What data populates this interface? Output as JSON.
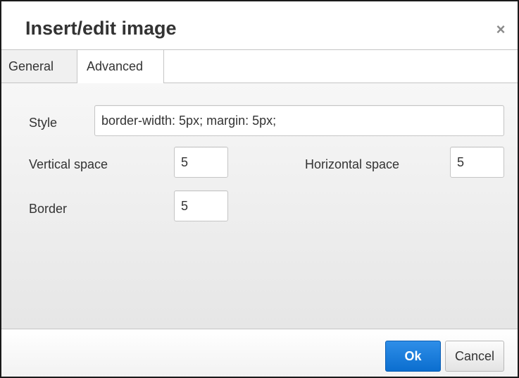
{
  "dialog": {
    "title": "Insert/edit image",
    "close_glyph": "×"
  },
  "tabs": [
    {
      "label": "General",
      "active": false
    },
    {
      "label": "Advanced",
      "active": true
    }
  ],
  "form": {
    "style": {
      "label": "Style",
      "value": "border-width: 5px; margin: 5px;"
    },
    "vertical_space": {
      "label": "Vertical space",
      "value": "5"
    },
    "horizontal_space": {
      "label": "Horizontal space",
      "value": "5"
    },
    "border": {
      "label": "Border",
      "value": "5"
    }
  },
  "buttons": {
    "ok_label": "Ok",
    "cancel_label": "Cancel"
  },
  "colors": {
    "accent": "#0b6ecf",
    "panel_bg": "#f0f0f0"
  },
  "icons": {
    "close": "close-icon"
  }
}
